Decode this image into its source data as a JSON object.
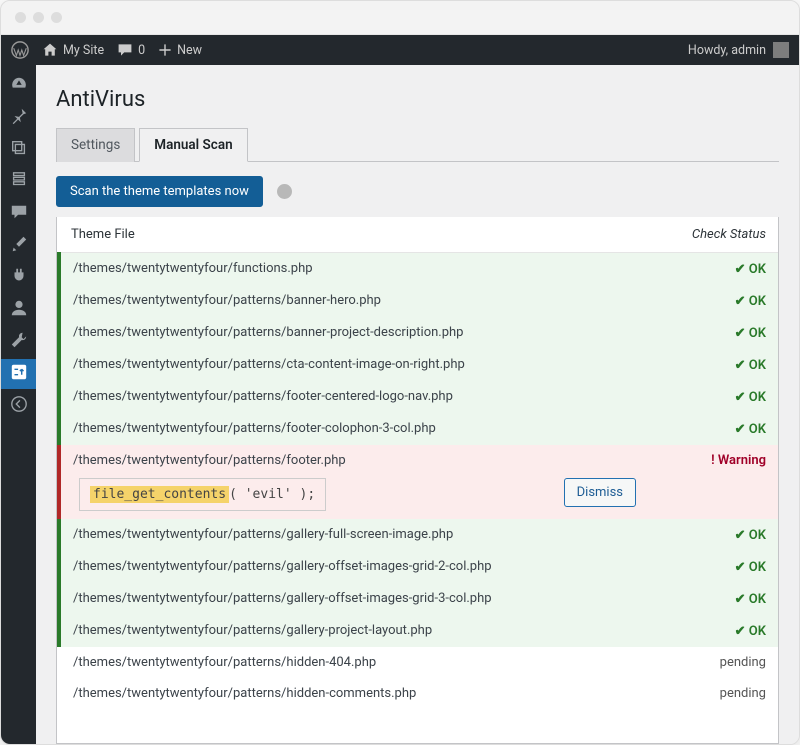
{
  "adminbar": {
    "site_name": "My Site",
    "comment_count": "0",
    "new_label": "New",
    "greeting": "Howdy, admin"
  },
  "sidebar": {
    "items": [
      {
        "name": "dashboard",
        "icon": "gauge"
      },
      {
        "name": "posts",
        "icon": "pin"
      },
      {
        "name": "media",
        "icon": "media"
      },
      {
        "name": "pages",
        "icon": "page"
      },
      {
        "name": "comments",
        "icon": "comment"
      },
      {
        "name": "appearance",
        "icon": "brush"
      },
      {
        "name": "plugins",
        "icon": "plug"
      },
      {
        "name": "users",
        "icon": "user"
      },
      {
        "name": "tools",
        "icon": "wrench"
      },
      {
        "name": "antivirus",
        "icon": "sliders",
        "current": true
      },
      {
        "name": "collapse",
        "icon": "collapse"
      }
    ]
  },
  "page": {
    "title": "AntiVirus",
    "tabs": [
      {
        "label": "Settings",
        "active": false
      },
      {
        "label": "Manual Scan",
        "active": true
      }
    ],
    "scan_button": "Scan the theme templates now"
  },
  "table": {
    "head_file": "Theme File",
    "head_status": "Check Status",
    "ok_label": "OK",
    "warning_label": "Warning",
    "pending_label": "pending",
    "dismiss_label": "Dismiss",
    "rows": [
      {
        "file": "/themes/twentytwentyfour/functions.php",
        "state": "ok"
      },
      {
        "file": "/themes/twentytwentyfour/patterns/banner-hero.php",
        "state": "ok"
      },
      {
        "file": "/themes/twentytwentyfour/patterns/banner-project-description.php",
        "state": "ok"
      },
      {
        "file": "/themes/twentytwentyfour/patterns/cta-content-image-on-right.php",
        "state": "ok"
      },
      {
        "file": "/themes/twentytwentyfour/patterns/footer-centered-logo-nav.php",
        "state": "ok"
      },
      {
        "file": "/themes/twentytwentyfour/patterns/footer-colophon-3-col.php",
        "state": "ok"
      },
      {
        "file": "/themes/twentytwentyfour/patterns/footer.php",
        "state": "warn",
        "code_hl": "file_get_contents",
        "code_rest": "( 'evil' );"
      },
      {
        "file": "/themes/twentytwentyfour/patterns/gallery-full-screen-image.php",
        "state": "ok"
      },
      {
        "file": "/themes/twentytwentyfour/patterns/gallery-offset-images-grid-2-col.php",
        "state": "ok"
      },
      {
        "file": "/themes/twentytwentyfour/patterns/gallery-offset-images-grid-3-col.php",
        "state": "ok"
      },
      {
        "file": "/themes/twentytwentyfour/patterns/gallery-project-layout.php",
        "state": "ok"
      },
      {
        "file": "/themes/twentytwentyfour/patterns/hidden-404.php",
        "state": "pending"
      },
      {
        "file": "/themes/twentytwentyfour/patterns/hidden-comments.php",
        "state": "pending"
      }
    ]
  }
}
